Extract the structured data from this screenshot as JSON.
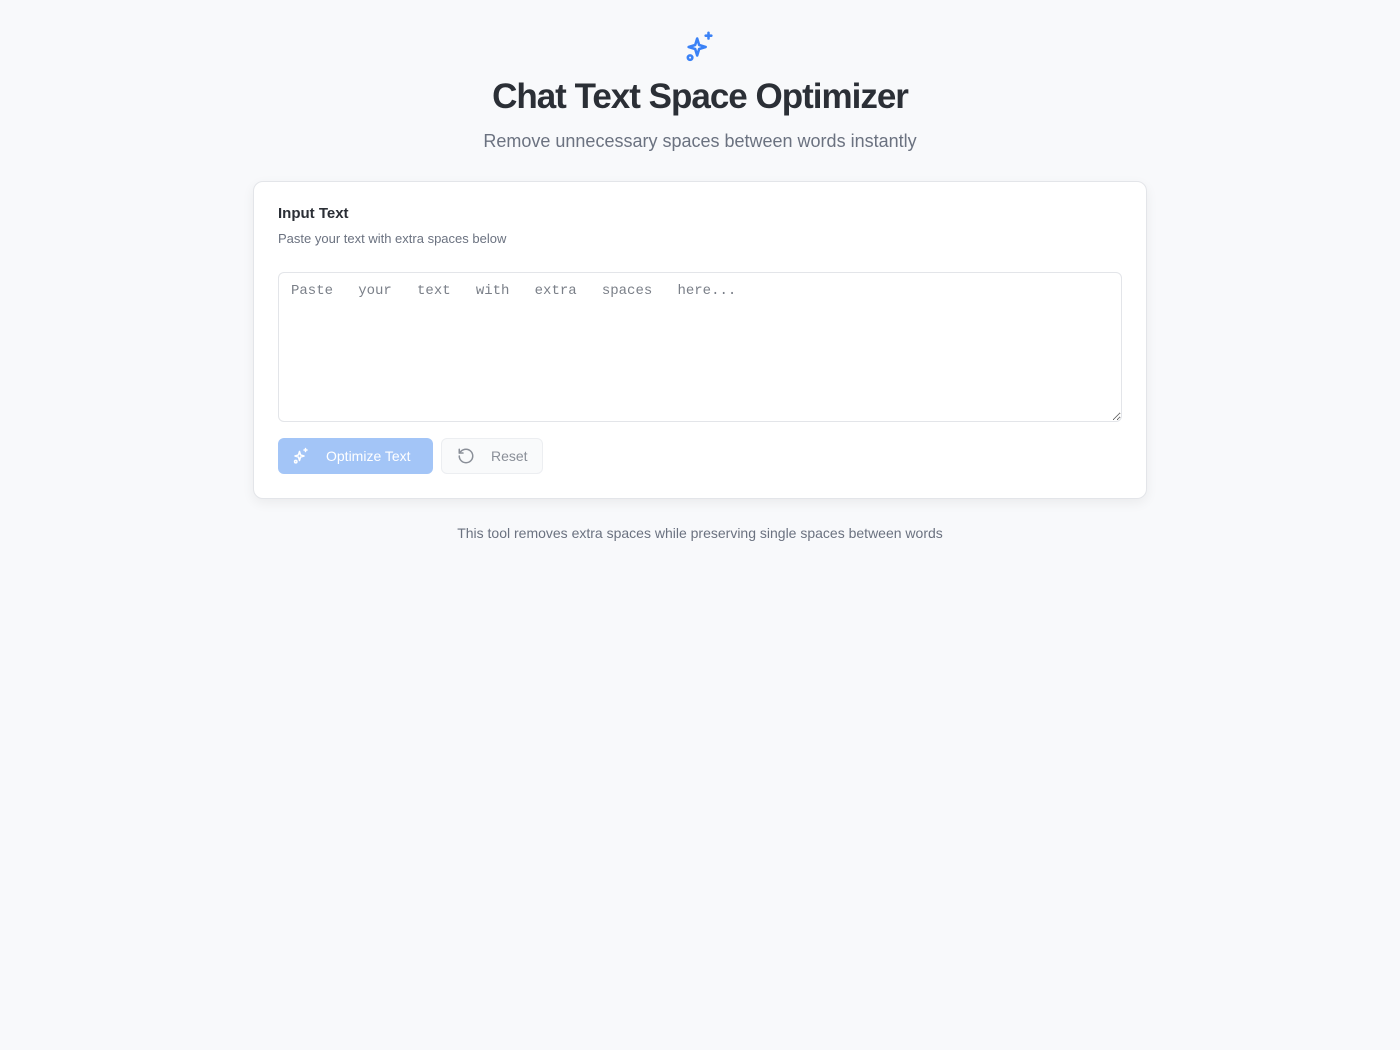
{
  "header": {
    "icon": "sparkles-icon",
    "title": "Chat Text Space Optimizer",
    "subtitle": "Remove unnecessary spaces between words instantly"
  },
  "card": {
    "title": "Input Text",
    "description": "Paste your text with extra spaces below",
    "input": {
      "value": "",
      "placeholder": "Paste   your   text   with   extra   spaces   here..."
    },
    "optimize_button": {
      "label": "Optimize Text",
      "icon": "sparkles-icon",
      "disabled": true
    },
    "reset_button": {
      "label": "Reset",
      "icon": "rotate-ccw-icon"
    }
  },
  "footer": {
    "note": "This tool removes extra spaces while preserving single spaces between words"
  },
  "colors": {
    "accent": "#3b82f6",
    "accent_disabled": "#a3c5f7",
    "background": "#f8f9fb",
    "card": "#ffffff",
    "text_primary": "#2b2f36",
    "text_muted": "#6b7280"
  }
}
